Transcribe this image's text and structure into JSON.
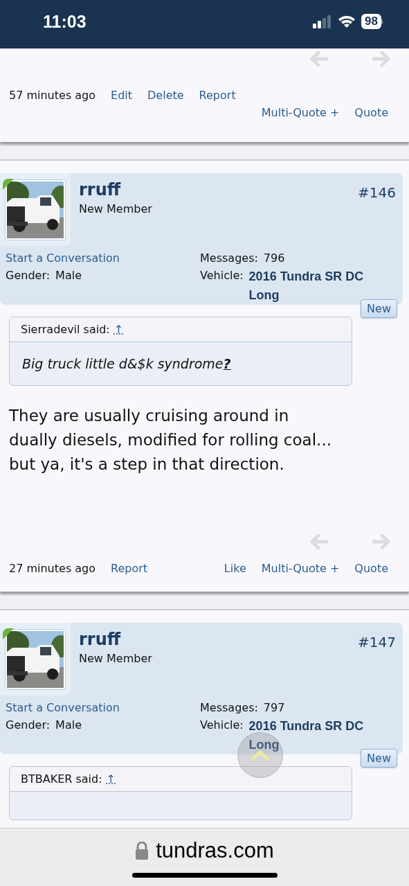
{
  "status_bar": {
    "time": "11:03",
    "battery": "98"
  },
  "posts": [
    {
      "kind": "tail",
      "footer": {
        "time": "57 minutes ago",
        "left_links": [
          "Edit",
          "Delete",
          "Report"
        ],
        "right_links": [
          "Multi-Quote +",
          "Quote"
        ]
      }
    },
    {
      "kind": "full",
      "user": {
        "name": "rruff",
        "title": "New Member",
        "number": "#146",
        "conversation_link": "Start a Conversation",
        "gender_label": "Gender:",
        "gender": "Male",
        "messages_label": "Messages:",
        "messages": "796",
        "vehicle_label": "Vehicle:",
        "vehicle": "2016 Tundra SR DC Long"
      },
      "badge": "New",
      "quote": {
        "author": "Sierradevil said:",
        "jump": "↑",
        "text": "Big truck little d&$k syndrome**?**"
      },
      "body": "They are usually cruising around in dually diesels, modified for rolling coal... but ya, it's a step in that direction.",
      "footer": {
        "time": "27 minutes ago",
        "left_links": [
          "Report"
        ],
        "right_links": [
          "Like",
          "Multi-Quote +",
          "Quote"
        ]
      }
    },
    {
      "kind": "head",
      "user": {
        "name": "rruff",
        "title": "New Member",
        "number": "#147",
        "conversation_link": "Start a Conversation",
        "gender_label": "Gender:",
        "gender": "Male",
        "messages_label": "Messages:",
        "messages": "797",
        "vehicle_label": "Vehicle:",
        "vehicle": "2016 Tundra SR DC Long"
      },
      "badge": "New",
      "quote": {
        "author": "BTBAKER said:",
        "jump": "↑"
      }
    }
  ],
  "browser_bar": {
    "url": "tundras.com"
  }
}
